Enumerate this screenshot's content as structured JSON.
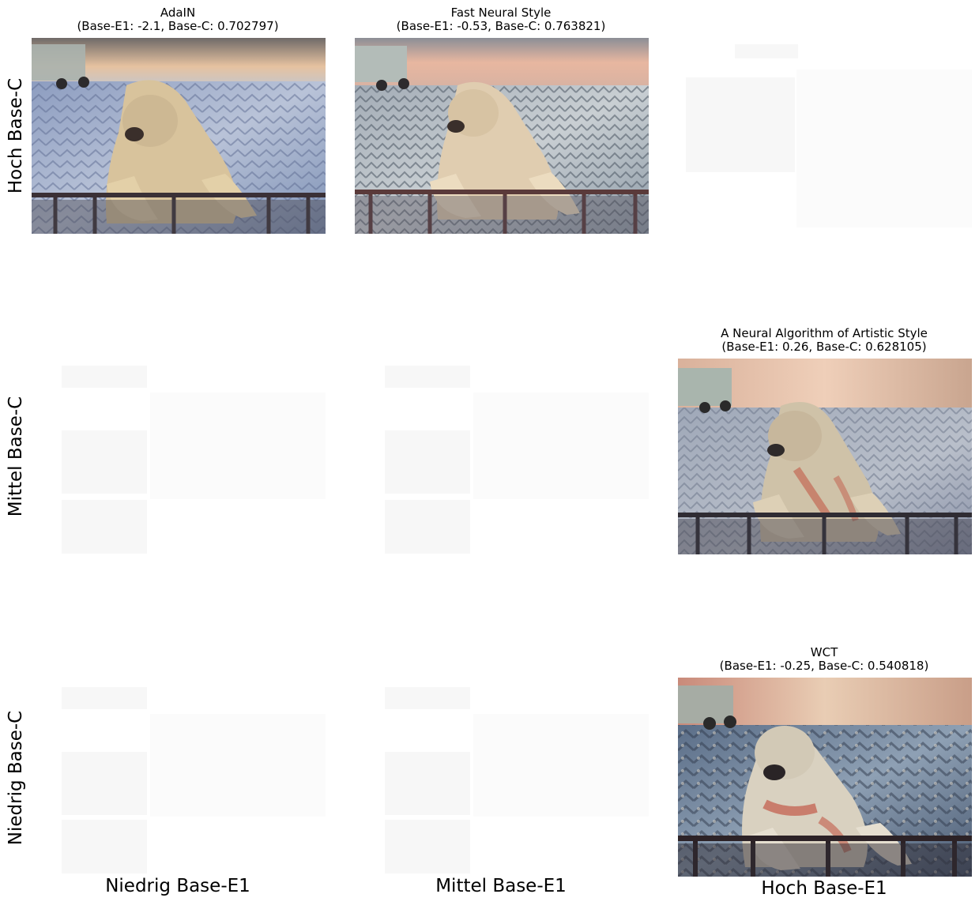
{
  "rows": [
    {
      "label": "Hoch Base-C"
    },
    {
      "label": "Mittel Base-C"
    },
    {
      "label": "Niedrig Base-C"
    }
  ],
  "columns": [
    {
      "label": "Niedrig Base-E1"
    },
    {
      "label": "Mittel Base-E1"
    },
    {
      "label": "Hoch Base-E1"
    }
  ],
  "panels": [
    {
      "method": "AdaIN",
      "scores": "(Base-E1: -2.1, Base-C: 0.702797)",
      "base_e1": -2.1,
      "base_c": 0.702797
    },
    {
      "method": "Fast Neural Style",
      "scores": "(Base-E1: -0.53, Base-C: 0.763821)",
      "base_e1": -0.53,
      "base_c": 0.763821
    },
    {
      "method": "A Neural Algorithm of Artistic Style",
      "scores": "(Base-E1: 0.26, Base-C: 0.628105)",
      "base_e1": 0.26,
      "base_c": 0.628105
    },
    {
      "method": "WCT",
      "scores": "(Base-E1: -0.25, Base-C: 0.540818)",
      "base_e1": -0.25,
      "base_c": 0.540818
    }
  ],
  "colors": {
    "snow": "#a9b6cf",
    "sky": "#e8c8a8",
    "fur": "#d8c8a4",
    "fence": "#3a3036",
    "accent_red": "#c25a48"
  }
}
